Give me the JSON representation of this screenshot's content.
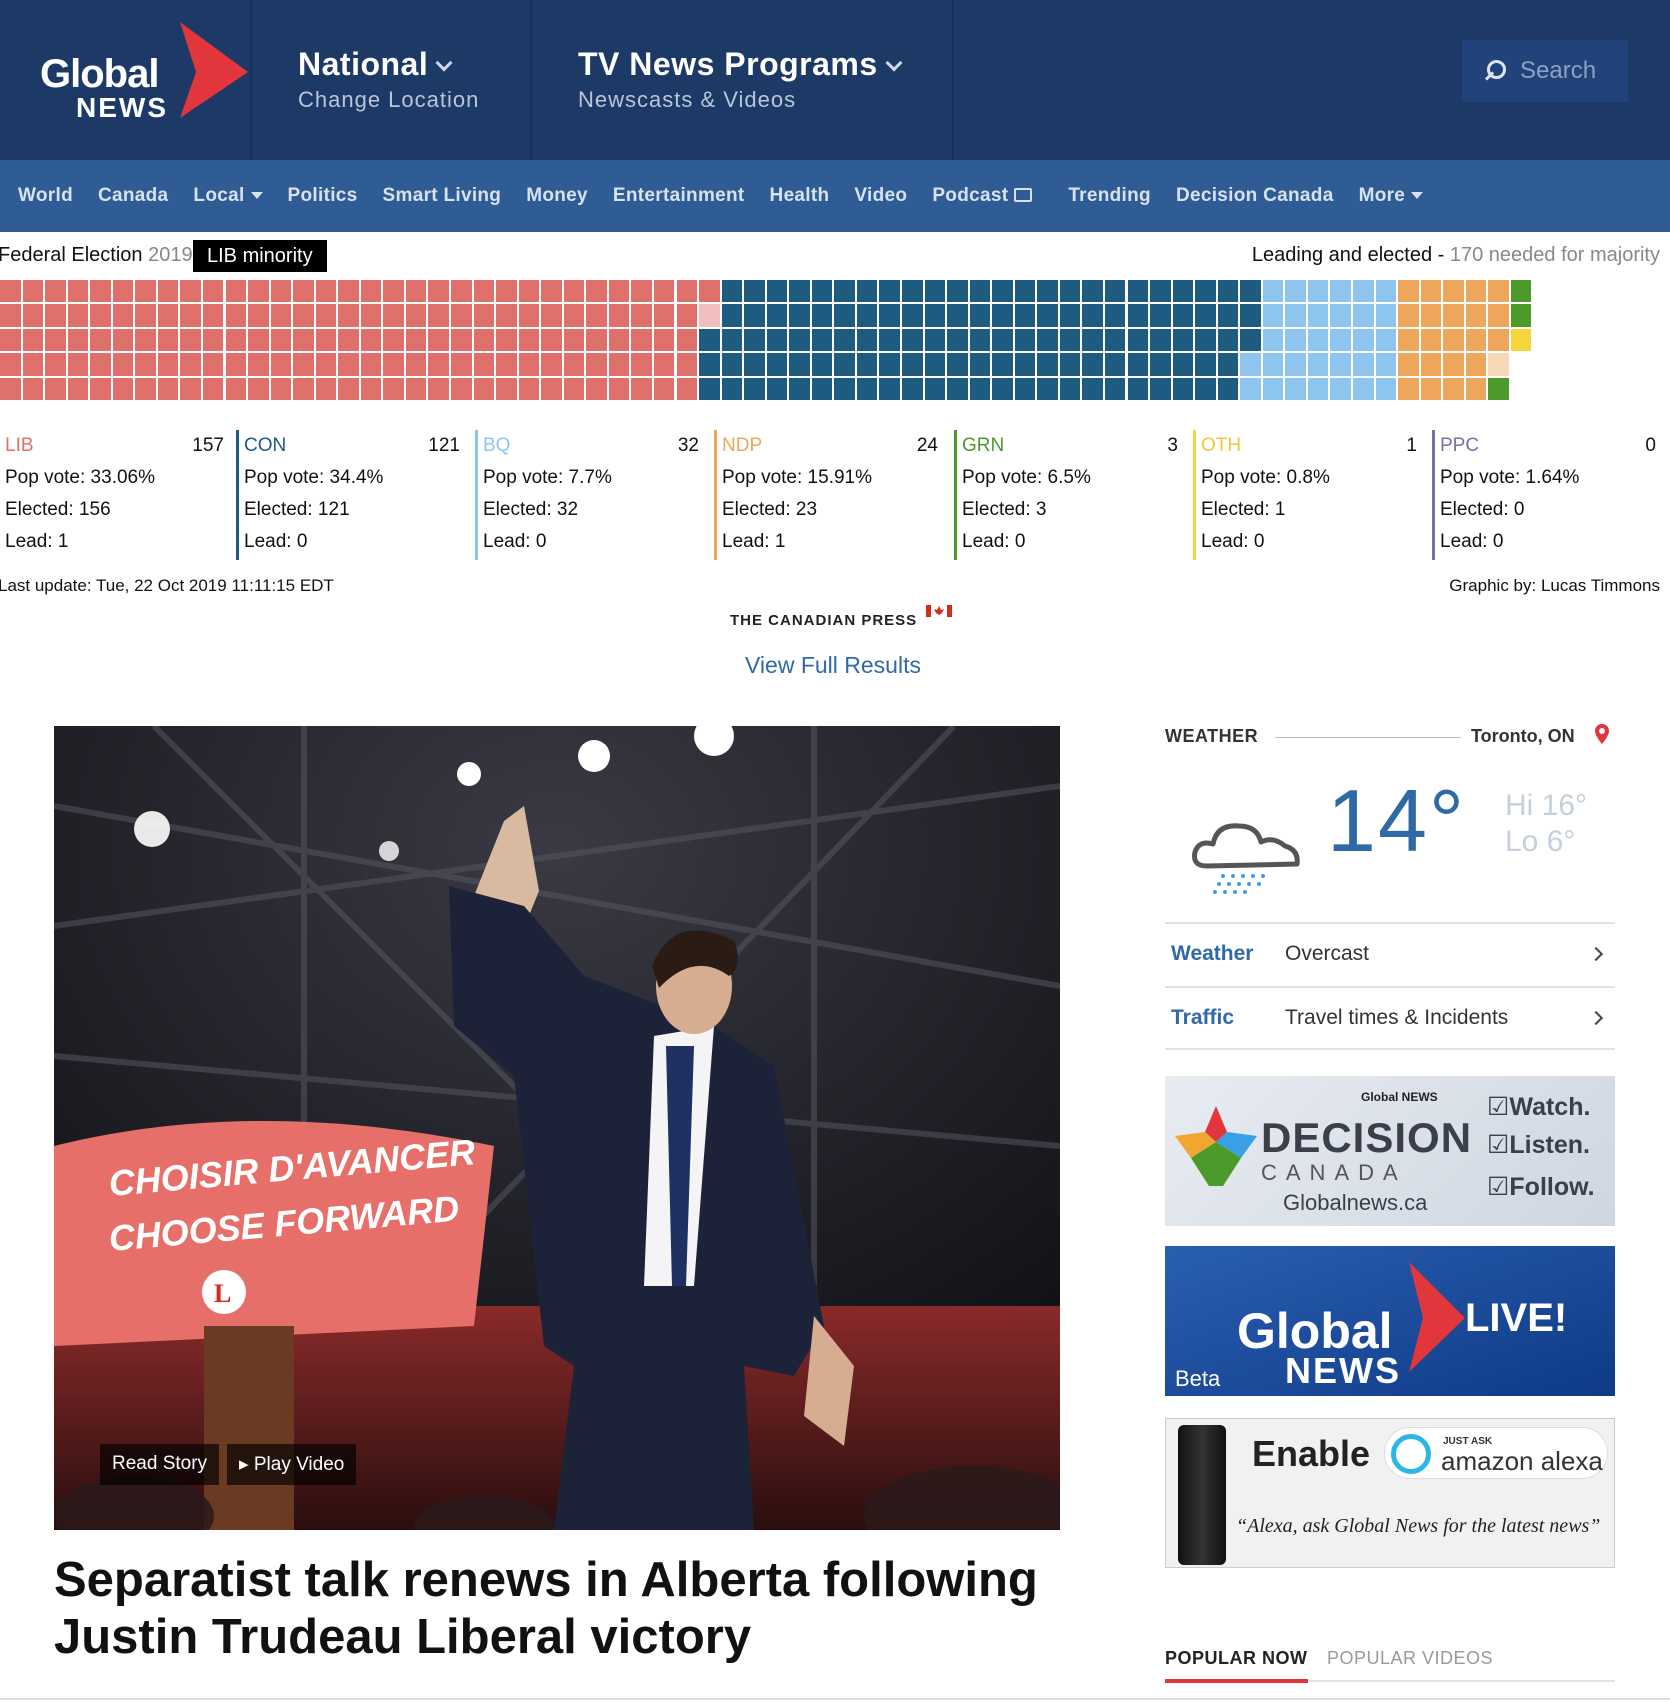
{
  "header": {
    "logo_top": "Global",
    "logo_bottom": "NEWS",
    "edition_title": "National",
    "edition_sub": "Change Location",
    "programs_title": "TV News Programs",
    "programs_sub": "Newscasts & Videos",
    "search_placeholder": "Search"
  },
  "nav": {
    "items": [
      "World",
      "Canada",
      "Local",
      "Politics",
      "Smart Living",
      "Money",
      "Entertainment",
      "Health",
      "Video",
      "Podcast",
      "Trending",
      "Decision Canada",
      "More"
    ]
  },
  "election": {
    "title": "Federal Election",
    "year": "2019",
    "status_tag": "LIB minority",
    "right_label": "Leading and elected -",
    "right_sub": "170 needed for majority",
    "parties": [
      {
        "name": "LIB",
        "total": "157",
        "pop": "Pop vote: 33.06%",
        "elected": "Elected: 156",
        "lead": "Lead: 1",
        "color": "#e0706c",
        "elected_n": 156,
        "lead_n": 1
      },
      {
        "name": "CON",
        "total": "121",
        "pop": "Pop vote: 34.4%",
        "elected": "Elected: 121",
        "lead": "Lead: 0",
        "color": "#1f5a80",
        "elected_n": 121,
        "lead_n": 0
      },
      {
        "name": "BQ",
        "total": "32",
        "pop": "Pop vote: 7.7%",
        "elected": "Elected: 32",
        "lead": "Lead: 0",
        "color": "#8ec5ee",
        "elected_n": 32,
        "lead_n": 0
      },
      {
        "name": "NDP",
        "total": "24",
        "pop": "Pop vote: 15.91%",
        "elected": "Elected: 23",
        "lead": "Lead: 1",
        "color": "#eea65c",
        "elected_n": 23,
        "lead_n": 1
      },
      {
        "name": "GRN",
        "total": "3",
        "pop": "Pop vote: 6.5%",
        "elected": "Elected: 3",
        "lead": "Lead: 0",
        "color": "#4c9a2a",
        "elected_n": 3,
        "lead_n": 0
      },
      {
        "name": "OTH",
        "total": "1",
        "pop": "Pop vote: 0.8%",
        "elected": "Elected: 1",
        "lead": "Lead: 0",
        "color": "#f5d63a",
        "elected_n": 1,
        "lead_n": 0
      },
      {
        "name": "PPC",
        "total": "0",
        "pop": "Pop vote: 1.64%",
        "elected": "Elected: 0",
        "lead": "Lead: 0",
        "color": "#7a6ea8",
        "elected_n": 0,
        "lead_n": 0
      }
    ],
    "last_update": "Last update: Tue, 22 Oct 2019 11:11:15 EDT",
    "credit": "Graphic by: Lucas Timmons",
    "source": "THE CANADIAN PRESS",
    "full_results": "View Full Results"
  },
  "hero": {
    "read_story": "Read Story",
    "play_video": "▸ Play Video",
    "headline": "Separatist talk renews in Alberta following Justin Trudeau Liberal victory",
    "sign_line1": "CHOISIR D'AVANCER",
    "sign_line2": "CHOOSE FORWARD"
  },
  "weather": {
    "label": "WEATHER",
    "location": "Toronto, ON",
    "temp": "14°",
    "hi": "Hi 16°",
    "lo": "Lo 6°",
    "rows": [
      {
        "key": "Weather",
        "value": "Overcast"
      },
      {
        "key": "Traffic",
        "value": "Travel times & Incidents"
      }
    ]
  },
  "ads": {
    "decision": {
      "brand": "Global NEWS",
      "title": "DECISION",
      "sub": "CANADA",
      "url": "Globalnews.ca",
      "checks": [
        "☑Watch.",
        "☑Listen.",
        "☑Follow."
      ]
    },
    "live": {
      "top": "Global",
      "bottom": "NEWS",
      "live": "LIVE!",
      "beta": "Beta"
    },
    "alexa": {
      "enable": "Enable",
      "just_ask": "JUST ASK",
      "brand": "amazon alexa",
      "quote": "“Alexa, ask Global News for the latest news”"
    }
  },
  "popular": {
    "tab_active": "POPULAR NOW",
    "tab_other": "POPULAR VIDEOS"
  },
  "colors": {
    "header": "#1d3a66",
    "nav": "#2f5c94",
    "link": "#2f6aa6",
    "accent_red": "#e0363c"
  }
}
